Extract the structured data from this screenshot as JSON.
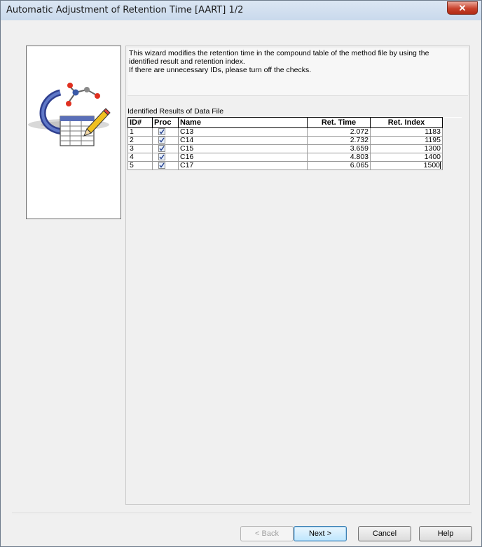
{
  "window": {
    "title": "Automatic Adjustment of Retention Time [AART] 1/2",
    "close_glyph": "✕"
  },
  "description": {
    "line1": "This wizard modifies the retention time in the compound table of the method file by using the",
    "line2": "identified result and retention index.",
    "line3": "If there are unnecessary IDs, please turn off the checks."
  },
  "results": {
    "label": "Identified Results of Data File",
    "columns": {
      "id": "ID#",
      "proc": "Proc",
      "name": "Name",
      "ret_time": "Ret. Time",
      "ret_index": "Ret. Index"
    },
    "rows": [
      {
        "id": "1",
        "proc": true,
        "name": "C13",
        "ret_time": "2.072",
        "ret_index": "1183"
      },
      {
        "id": "2",
        "proc": true,
        "name": "C14",
        "ret_time": "2.732",
        "ret_index": "1195"
      },
      {
        "id": "3",
        "proc": true,
        "name": "C15",
        "ret_time": "3.659",
        "ret_index": "1300"
      },
      {
        "id": "4",
        "proc": true,
        "name": "C16",
        "ret_time": "4.803",
        "ret_index": "1400"
      },
      {
        "id": "5",
        "proc": true,
        "name": "C17",
        "ret_time": "6.065",
        "ret_index": "1500"
      }
    ]
  },
  "buttons": {
    "back": "< Back",
    "next": "Next >",
    "cancel": "Cancel",
    "help": "Help"
  },
  "colors": {
    "title_bar": "#c9d9ec",
    "close_button": "#c8412b",
    "default_button_border": "#3c7fb1"
  },
  "icons": {
    "wizard_graphic": "molecule-table-pencil-icon",
    "checkbox": "checkmark-icon"
  }
}
